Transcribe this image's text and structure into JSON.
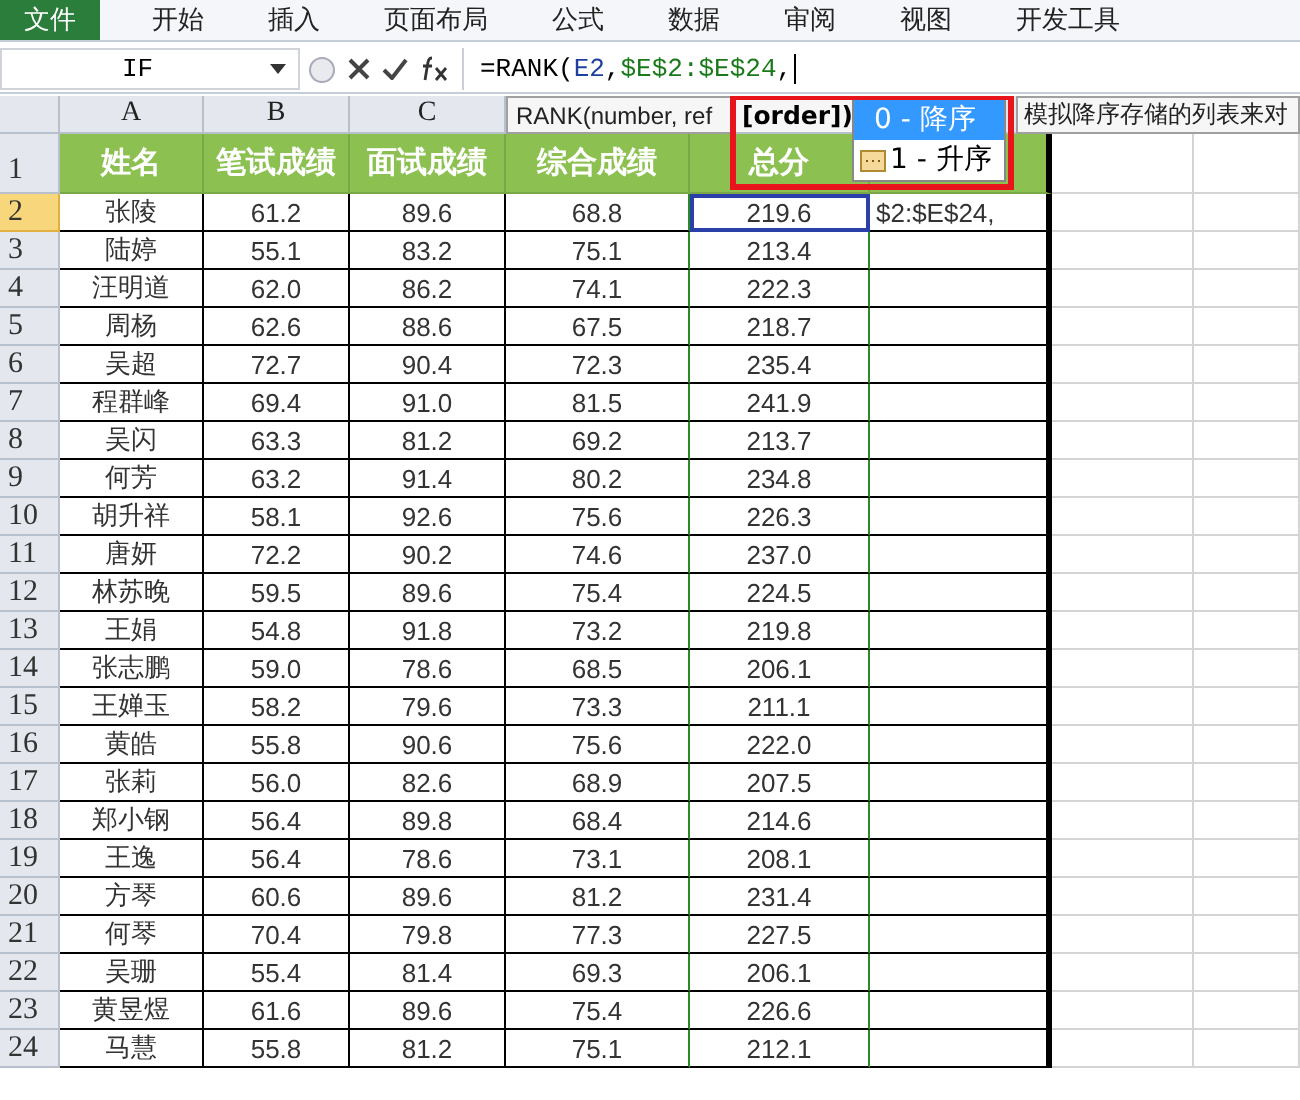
{
  "menu": [
    {
      "label": "文件",
      "selected": true
    },
    {
      "label": "开始",
      "selected": false
    },
    {
      "label": "插入",
      "selected": false
    },
    {
      "label": "页面布局",
      "selected": false
    },
    {
      "label": "公式",
      "selected": false
    },
    {
      "label": "数据",
      "selected": false
    },
    {
      "label": "审阅",
      "selected": false
    },
    {
      "label": "视图",
      "selected": false
    },
    {
      "label": "开发工具",
      "selected": false
    }
  ],
  "formula_bar": {
    "name_box": "IF",
    "formula": [
      {
        "text": "=RANK(",
        "color": "#000000"
      },
      {
        "text": "E2",
        "color": "#1f3fa0"
      },
      {
        "text": ",",
        "color": "#000000"
      },
      {
        "text": "$E$2:$E$24",
        "color": "#1a7a1a"
      },
      {
        "text": ",",
        "color": "#000000"
      }
    ]
  },
  "sheet": {
    "column_headers": [
      "A",
      "B",
      "C"
    ],
    "header_row": {
      "number": "1",
      "cells": [
        "姓名",
        "笔试成绩",
        "面试成绩",
        "综合成绩",
        "总分"
      ]
    },
    "rows": [
      {
        "number": "2",
        "selected": true,
        "cells": [
          "张陵",
          "61.2",
          "89.6",
          "68.8",
          "219.6"
        ],
        "edit_text": "$2:$E$24,"
      },
      {
        "number": "3",
        "selected": false,
        "cells": [
          "陆婷",
          "55.1",
          "83.2",
          "75.1",
          "213.4"
        ]
      },
      {
        "number": "4",
        "selected": false,
        "cells": [
          "汪明道",
          "62.0",
          "86.2",
          "74.1",
          "222.3"
        ]
      },
      {
        "number": "5",
        "selected": false,
        "cells": [
          "周杨",
          "62.6",
          "88.6",
          "67.5",
          "218.7"
        ]
      },
      {
        "number": "6",
        "selected": false,
        "cells": [
          "吴超",
          "72.7",
          "90.4",
          "72.3",
          "235.4"
        ]
      },
      {
        "number": "7",
        "selected": false,
        "cells": [
          "程群峰",
          "69.4",
          "91.0",
          "81.5",
          "241.9"
        ]
      },
      {
        "number": "8",
        "selected": false,
        "cells": [
          "吴闪",
          "63.3",
          "81.2",
          "69.2",
          "213.7"
        ]
      },
      {
        "number": "9",
        "selected": false,
        "cells": [
          "何芳",
          "63.2",
          "91.4",
          "80.2",
          "234.8"
        ]
      },
      {
        "number": "10",
        "selected": false,
        "cells": [
          "胡升祥",
          "58.1",
          "92.6",
          "75.6",
          "226.3"
        ]
      },
      {
        "number": "11",
        "selected": false,
        "cells": [
          "唐妍",
          "72.2",
          "90.2",
          "74.6",
          "237.0"
        ]
      },
      {
        "number": "12",
        "selected": false,
        "cells": [
          "林苏晚",
          "59.5",
          "89.6",
          "75.4",
          "224.5"
        ]
      },
      {
        "number": "13",
        "selected": false,
        "cells": [
          "王娟",
          "54.8",
          "91.8",
          "73.2",
          "219.8"
        ]
      },
      {
        "number": "14",
        "selected": false,
        "cells": [
          "张志鹏",
          "59.0",
          "78.6",
          "68.5",
          "206.1"
        ]
      },
      {
        "number": "15",
        "selected": false,
        "cells": [
          "王婵玉",
          "58.2",
          "79.6",
          "73.3",
          "211.1"
        ]
      },
      {
        "number": "16",
        "selected": false,
        "cells": [
          "黄皓",
          "55.8",
          "90.6",
          "75.6",
          "222.0"
        ]
      },
      {
        "number": "17",
        "selected": false,
        "cells": [
          "张莉",
          "56.0",
          "82.6",
          "68.9",
          "207.5"
        ]
      },
      {
        "number": "18",
        "selected": false,
        "cells": [
          "郑小钢",
          "56.4",
          "89.8",
          "68.4",
          "214.6"
        ]
      },
      {
        "number": "19",
        "selected": false,
        "cells": [
          "王逸",
          "56.4",
          "78.6",
          "73.1",
          "208.1"
        ]
      },
      {
        "number": "20",
        "selected": false,
        "cells": [
          "方琴",
          "60.6",
          "89.6",
          "81.2",
          "231.4"
        ]
      },
      {
        "number": "21",
        "selected": false,
        "cells": [
          "何琴",
          "70.4",
          "79.8",
          "77.3",
          "227.5"
        ]
      },
      {
        "number": "22",
        "selected": false,
        "cells": [
          "吴珊",
          "55.4",
          "81.4",
          "69.3",
          "206.1"
        ]
      },
      {
        "number": "23",
        "selected": false,
        "cells": [
          "黄昱煜",
          "61.6",
          "89.6",
          "75.4",
          "226.6"
        ]
      },
      {
        "number": "24",
        "selected": false,
        "cells": [
          "马慧",
          "55.8",
          "81.2",
          "75.1",
          "212.1"
        ]
      }
    ]
  },
  "function_tooltip": {
    "signature": "RANK(number, ref",
    "current_argument": "[order])",
    "options": [
      {
        "label": "0 - 降序",
        "selected": true
      },
      {
        "label": "1 - 升序",
        "selected": false
      }
    ],
    "description": "模拟降序存储的列表来对"
  }
}
